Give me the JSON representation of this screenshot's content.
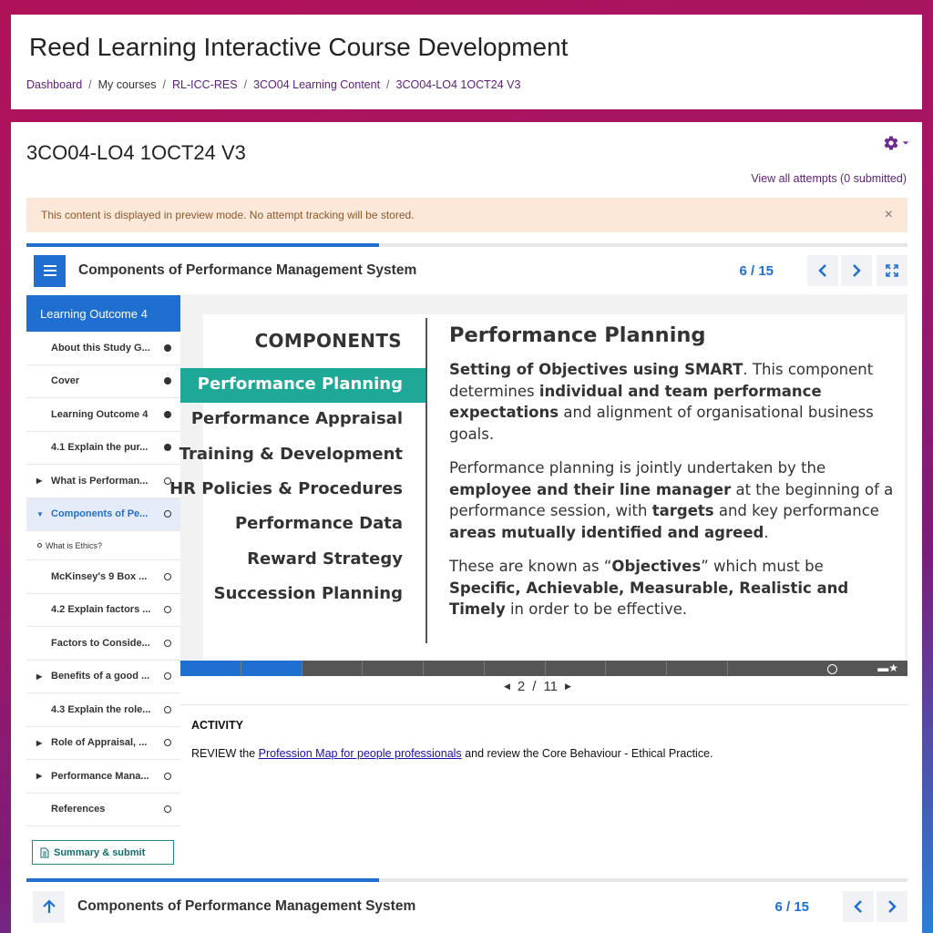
{
  "header": {
    "site_title": "Reed Learning Interactive Course Development",
    "breadcrumb": [
      "Dashboard",
      "My courses",
      "RL-ICC-RES",
      "3CO04 Learning Content",
      "3CO04-LO4 1OCT24 V3"
    ]
  },
  "page": {
    "title": "3CO04-LO4 1OCT24 V3",
    "view_attempts": "View all attempts (0 submitted)",
    "preview_notice": "This content is displayed in preview mode. No attempt tracking will be stored.",
    "close_glyph": "×"
  },
  "course_bar": {
    "title": "Components of Performance Management System",
    "page_count": "6 / 15",
    "progress_fraction": 0.4
  },
  "sidebar": {
    "section_title": "Learning Outcome 4",
    "items": [
      {
        "label": "About this Study G...",
        "status": "done",
        "expandable": false
      },
      {
        "label": "Cover",
        "status": "done",
        "expandable": false
      },
      {
        "label": "Learning Outcome 4",
        "status": "done",
        "expandable": false
      },
      {
        "label": "4.1 Explain the pur...",
        "status": "done",
        "expandable": false
      },
      {
        "label": "What is Performan...",
        "status": "open",
        "expandable": true
      },
      {
        "label": "Components of Pe...",
        "status": "open",
        "expandable": true,
        "active": true
      },
      {
        "label": "What is Ethics?",
        "sub": true
      },
      {
        "label": "McKinsey's 9 Box ...",
        "status": "open",
        "expandable": false
      },
      {
        "label": "4.2 Explain factors ...",
        "status": "open",
        "expandable": false
      },
      {
        "label": "Factors to Conside...",
        "status": "open",
        "expandable": false
      },
      {
        "label": "Benefits of a good ...",
        "status": "open",
        "expandable": true
      },
      {
        "label": "4.3 Explain the role...",
        "status": "open",
        "expandable": false
      },
      {
        "label": "Role of Appraisal, ...",
        "status": "open",
        "expandable": true
      },
      {
        "label": "Performance Mana...",
        "status": "open",
        "expandable": true
      },
      {
        "label": "References",
        "status": "open",
        "expandable": false
      }
    ],
    "summary_button": "Summary & submit"
  },
  "slide": {
    "components_heading": "COMPONENTS",
    "components": [
      "Performance Planning",
      "Performance Appraisal",
      "Training & Development",
      "HR Policies & Procedures",
      "Performance Data",
      "Reward Strategy",
      "Succession Planning"
    ],
    "selected_index": 0,
    "detail_title": "Performance Planning",
    "pager_current": "2",
    "pager_total": "11",
    "pager_sep": "/",
    "progress_done_segments": 2
  },
  "activity": {
    "title": "ACTIVITY",
    "text_before": "REVIEW the ",
    "link_text": "Profession Map for people professionals",
    "text_after": " and review the Core Behaviour - Ethical Practice."
  },
  "colors": {
    "accent": "#1f6fd1",
    "highlight": "#1ea897",
    "brand_purple": "#5c1f7a"
  }
}
